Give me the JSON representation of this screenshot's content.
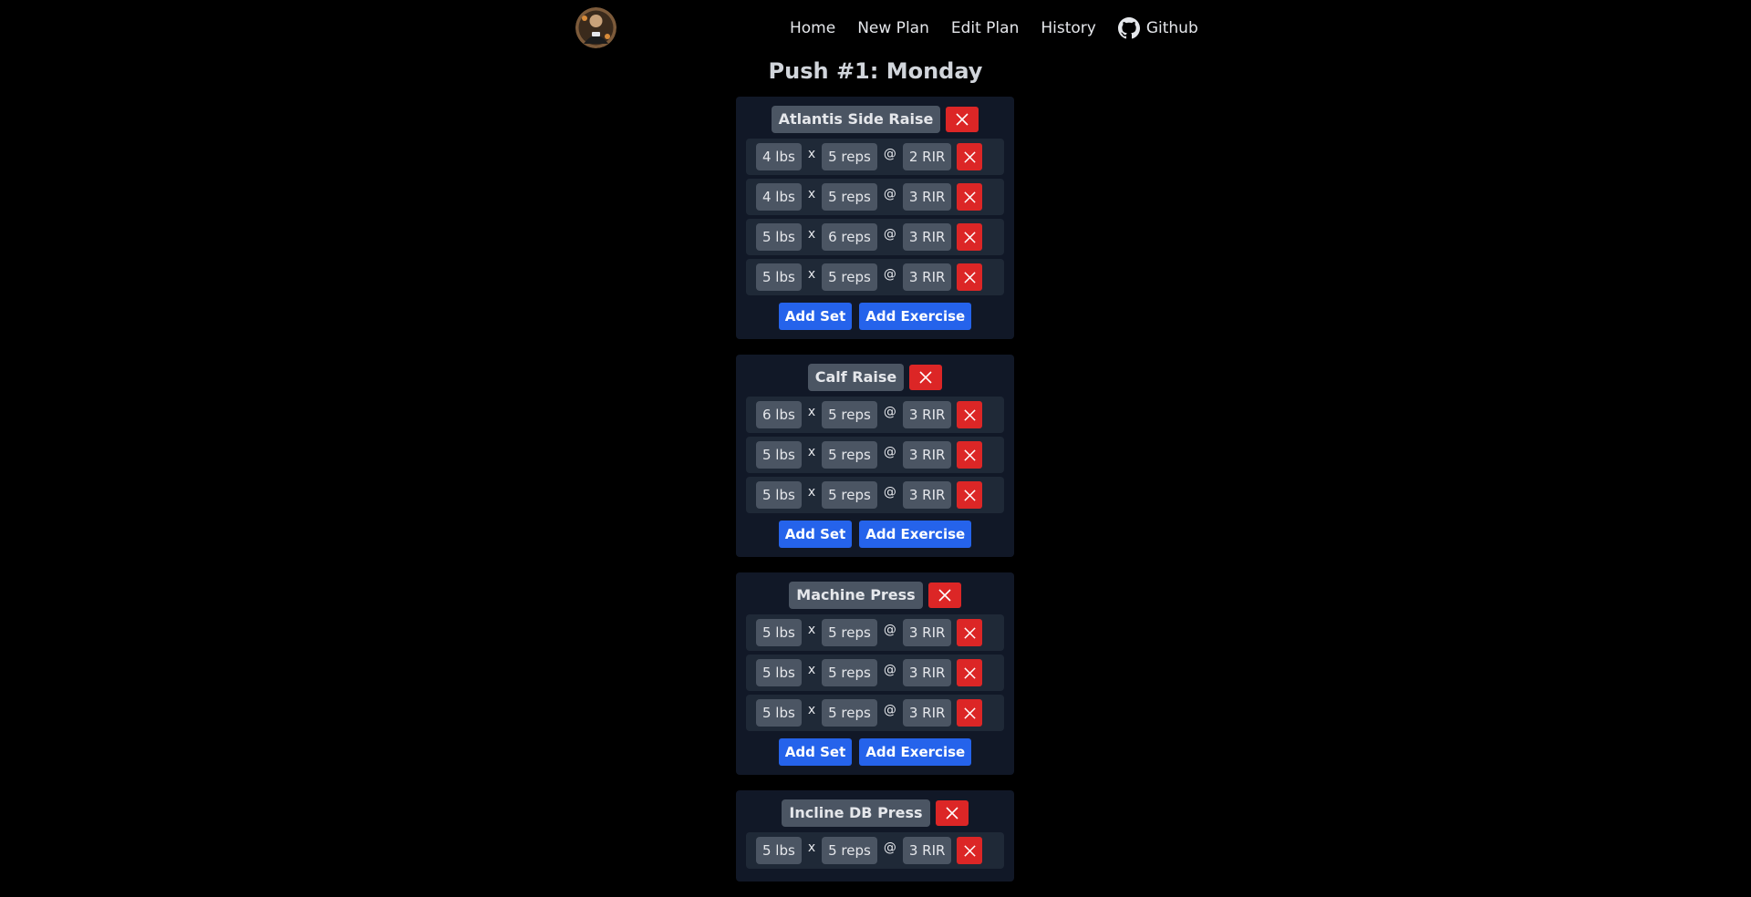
{
  "nav": {
    "links": [
      "Home",
      "New Plan",
      "Edit Plan",
      "History"
    ],
    "github_label": "Github"
  },
  "page": {
    "title": "Push #1: Monday"
  },
  "exercises": [
    {
      "name": "Atlantis Side Raise",
      "sets": [
        {
          "weight": "4 lbs",
          "reps": "5 reps",
          "rir": "2 RIR"
        },
        {
          "weight": "4 lbs",
          "reps": "5 reps",
          "rir": "3 RIR"
        },
        {
          "weight": "5 lbs",
          "reps": "6 reps",
          "rir": "3 RIR"
        },
        {
          "weight": "5 lbs",
          "reps": "5 reps",
          "rir": "3 RIR"
        }
      ]
    },
    {
      "name": "Calf Raise",
      "sets": [
        {
          "weight": "6 lbs",
          "reps": "5 reps",
          "rir": "3 RIR"
        },
        {
          "weight": "5 lbs",
          "reps": "5 reps",
          "rir": "3 RIR"
        },
        {
          "weight": "5 lbs",
          "reps": "5 reps",
          "rir": "3 RIR"
        }
      ]
    },
    {
      "name": "Machine Press",
      "sets": [
        {
          "weight": "5 lbs",
          "reps": "5 reps",
          "rir": "3 RIR"
        },
        {
          "weight": "5 lbs",
          "reps": "5 reps",
          "rir": "3 RIR"
        },
        {
          "weight": "5 lbs",
          "reps": "5 reps",
          "rir": "3 RIR"
        }
      ]
    },
    {
      "name": "Incline DB Press",
      "sets": [
        {
          "weight": "5 lbs",
          "reps": "5 reps",
          "rir": "3 RIR"
        }
      ]
    }
  ],
  "labels": {
    "times": "x",
    "at": "@",
    "add_set": "Add Set",
    "add_exercise": "Add Exercise"
  },
  "icons": {
    "avatar": "avatar-image",
    "github": "github-icon",
    "delete": "close-icon"
  },
  "colors": {
    "background": "#000000",
    "card": "#111827",
    "row": "#1f2937",
    "chip": "#4b5563",
    "danger": "#dc2626",
    "primary": "#2563eb"
  }
}
